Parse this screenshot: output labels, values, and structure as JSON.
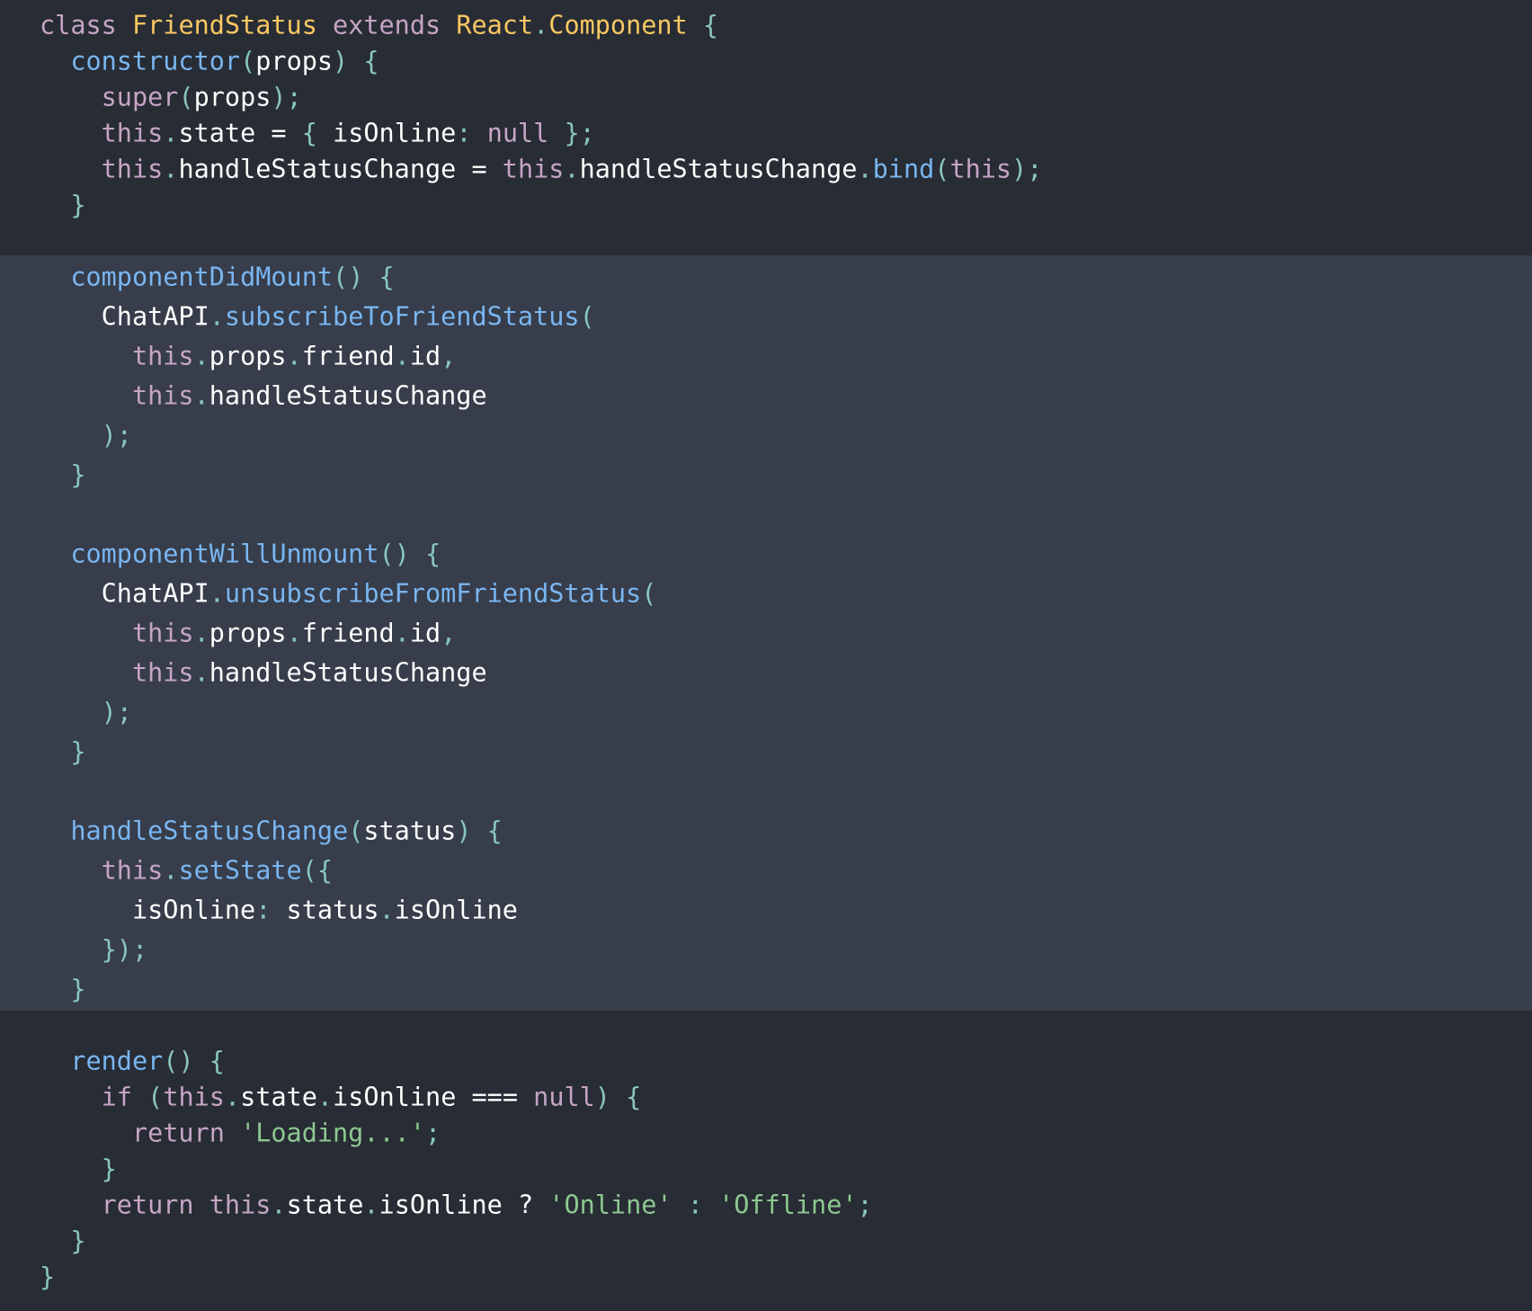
{
  "code": {
    "language": "javascript",
    "colors": {
      "background": "#282c34",
      "highlight_background": "#373d4a",
      "keyword": "#c5a5c5",
      "class_name": "#fac863",
      "function": "#79b6f2",
      "punctuation": "#88c6be",
      "string": "#8dc891",
      "plain": "#ffffff"
    },
    "highlighted_lines": [
      7,
      25
    ],
    "lines": [
      {
        "tokens": [
          [
            "keyword",
            "class"
          ],
          [
            "plain",
            " "
          ],
          [
            "class",
            "FriendStatus"
          ],
          [
            "plain",
            " "
          ],
          [
            "keyword",
            "extends"
          ],
          [
            "plain",
            " "
          ],
          [
            "class",
            "React"
          ],
          [
            "punct",
            "."
          ],
          [
            "class",
            "Component"
          ],
          [
            "plain",
            " "
          ],
          [
            "punct",
            "{"
          ]
        ]
      },
      {
        "tokens": [
          [
            "plain",
            "  "
          ],
          [
            "func",
            "constructor"
          ],
          [
            "punct",
            "("
          ],
          [
            "plain",
            "props"
          ],
          [
            "punct",
            ")"
          ],
          [
            "plain",
            " "
          ],
          [
            "punct",
            "{"
          ]
        ]
      },
      {
        "tokens": [
          [
            "plain",
            "    "
          ],
          [
            "keyword",
            "super"
          ],
          [
            "punct",
            "("
          ],
          [
            "plain",
            "props"
          ],
          [
            "punct",
            ");"
          ]
        ]
      },
      {
        "tokens": [
          [
            "plain",
            "    "
          ],
          [
            "keyword",
            "this"
          ],
          [
            "punct",
            "."
          ],
          [
            "plain",
            "state = "
          ],
          [
            "punct",
            "{"
          ],
          [
            "plain",
            " isOnline"
          ],
          [
            "punct",
            ":"
          ],
          [
            "plain",
            " "
          ],
          [
            "keyword",
            "null"
          ],
          [
            "plain",
            " "
          ],
          [
            "punct",
            "};"
          ]
        ]
      },
      {
        "tokens": [
          [
            "plain",
            "    "
          ],
          [
            "keyword",
            "this"
          ],
          [
            "punct",
            "."
          ],
          [
            "plain",
            "handleStatusChange = "
          ],
          [
            "keyword",
            "this"
          ],
          [
            "punct",
            "."
          ],
          [
            "plain",
            "handleStatusChange"
          ],
          [
            "punct",
            "."
          ],
          [
            "func",
            "bind"
          ],
          [
            "punct",
            "("
          ],
          [
            "keyword",
            "this"
          ],
          [
            "punct",
            ");"
          ]
        ]
      },
      {
        "tokens": [
          [
            "plain",
            "  "
          ],
          [
            "punct",
            "}"
          ]
        ]
      },
      {
        "tokens": []
      },
      {
        "tokens": [
          [
            "plain",
            "  "
          ],
          [
            "func",
            "componentDidMount"
          ],
          [
            "punct",
            "()"
          ],
          [
            "plain",
            " "
          ],
          [
            "punct",
            "{"
          ]
        ]
      },
      {
        "tokens": [
          [
            "plain",
            "    ChatAPI"
          ],
          [
            "punct",
            "."
          ],
          [
            "func",
            "subscribeToFriendStatus"
          ],
          [
            "punct",
            "("
          ]
        ]
      },
      {
        "tokens": [
          [
            "plain",
            "      "
          ],
          [
            "keyword",
            "this"
          ],
          [
            "punct",
            "."
          ],
          [
            "plain",
            "props"
          ],
          [
            "punct",
            "."
          ],
          [
            "plain",
            "friend"
          ],
          [
            "punct",
            "."
          ],
          [
            "plain",
            "id"
          ],
          [
            "punct",
            ","
          ]
        ]
      },
      {
        "tokens": [
          [
            "plain",
            "      "
          ],
          [
            "keyword",
            "this"
          ],
          [
            "punct",
            "."
          ],
          [
            "plain",
            "handleStatusChange"
          ]
        ]
      },
      {
        "tokens": [
          [
            "plain",
            "    "
          ],
          [
            "punct",
            ");"
          ]
        ]
      },
      {
        "tokens": [
          [
            "plain",
            "  "
          ],
          [
            "punct",
            "}"
          ]
        ]
      },
      {
        "tokens": []
      },
      {
        "tokens": [
          [
            "plain",
            "  "
          ],
          [
            "func",
            "componentWillUnmount"
          ],
          [
            "punct",
            "()"
          ],
          [
            "plain",
            " "
          ],
          [
            "punct",
            "{"
          ]
        ]
      },
      {
        "tokens": [
          [
            "plain",
            "    ChatAPI"
          ],
          [
            "punct",
            "."
          ],
          [
            "func",
            "unsubscribeFromFriendStatus"
          ],
          [
            "punct",
            "("
          ]
        ]
      },
      {
        "tokens": [
          [
            "plain",
            "      "
          ],
          [
            "keyword",
            "this"
          ],
          [
            "punct",
            "."
          ],
          [
            "plain",
            "props"
          ],
          [
            "punct",
            "."
          ],
          [
            "plain",
            "friend"
          ],
          [
            "punct",
            "."
          ],
          [
            "plain",
            "id"
          ],
          [
            "punct",
            ","
          ]
        ]
      },
      {
        "tokens": [
          [
            "plain",
            "      "
          ],
          [
            "keyword",
            "this"
          ],
          [
            "punct",
            "."
          ],
          [
            "plain",
            "handleStatusChange"
          ]
        ]
      },
      {
        "tokens": [
          [
            "plain",
            "    "
          ],
          [
            "punct",
            ");"
          ]
        ]
      },
      {
        "tokens": [
          [
            "plain",
            "  "
          ],
          [
            "punct",
            "}"
          ]
        ]
      },
      {
        "tokens": []
      },
      {
        "tokens": [
          [
            "plain",
            "  "
          ],
          [
            "func",
            "handleStatusChange"
          ],
          [
            "punct",
            "("
          ],
          [
            "plain",
            "status"
          ],
          [
            "punct",
            ")"
          ],
          [
            "plain",
            " "
          ],
          [
            "punct",
            "{"
          ]
        ]
      },
      {
        "tokens": [
          [
            "plain",
            "    "
          ],
          [
            "keyword",
            "this"
          ],
          [
            "punct",
            "."
          ],
          [
            "func",
            "setState"
          ],
          [
            "punct",
            "({"
          ]
        ]
      },
      {
        "tokens": [
          [
            "plain",
            "      isOnline"
          ],
          [
            "punct",
            ":"
          ],
          [
            "plain",
            " status"
          ],
          [
            "punct",
            "."
          ],
          [
            "plain",
            "isOnline"
          ]
        ]
      },
      {
        "tokens": [
          [
            "plain",
            "    "
          ],
          [
            "punct",
            "});"
          ]
        ]
      },
      {
        "tokens": [
          [
            "plain",
            "  "
          ],
          [
            "punct",
            "}"
          ]
        ]
      },
      {
        "tokens": []
      },
      {
        "tokens": [
          [
            "plain",
            "  "
          ],
          [
            "func",
            "render"
          ],
          [
            "punct",
            "()"
          ],
          [
            "plain",
            " "
          ],
          [
            "punct",
            "{"
          ]
        ]
      },
      {
        "tokens": [
          [
            "plain",
            "    "
          ],
          [
            "keyword",
            "if"
          ],
          [
            "plain",
            " "
          ],
          [
            "punct",
            "("
          ],
          [
            "keyword",
            "this"
          ],
          [
            "punct",
            "."
          ],
          [
            "plain",
            "state"
          ],
          [
            "punct",
            "."
          ],
          [
            "plain",
            "isOnline === "
          ],
          [
            "keyword",
            "null"
          ],
          [
            "punct",
            ")"
          ],
          [
            "plain",
            " "
          ],
          [
            "punct",
            "{"
          ]
        ]
      },
      {
        "tokens": [
          [
            "plain",
            "      "
          ],
          [
            "keyword",
            "return"
          ],
          [
            "plain",
            " "
          ],
          [
            "string",
            "'Loading...'"
          ],
          [
            "punct",
            ";"
          ]
        ]
      },
      {
        "tokens": [
          [
            "plain",
            "    "
          ],
          [
            "punct",
            "}"
          ]
        ]
      },
      {
        "tokens": [
          [
            "plain",
            "    "
          ],
          [
            "keyword",
            "return"
          ],
          [
            "plain",
            " "
          ],
          [
            "keyword",
            "this"
          ],
          [
            "punct",
            "."
          ],
          [
            "plain",
            "state"
          ],
          [
            "punct",
            "."
          ],
          [
            "plain",
            "isOnline ? "
          ],
          [
            "string",
            "'Online'"
          ],
          [
            "plain",
            " "
          ],
          [
            "punct",
            ":"
          ],
          [
            "plain",
            " "
          ],
          [
            "string",
            "'Offline'"
          ],
          [
            "punct",
            ";"
          ]
        ]
      },
      {
        "tokens": [
          [
            "plain",
            "  "
          ],
          [
            "punct",
            "}"
          ]
        ]
      },
      {
        "tokens": [
          [
            "punct",
            "}"
          ]
        ]
      }
    ]
  }
}
